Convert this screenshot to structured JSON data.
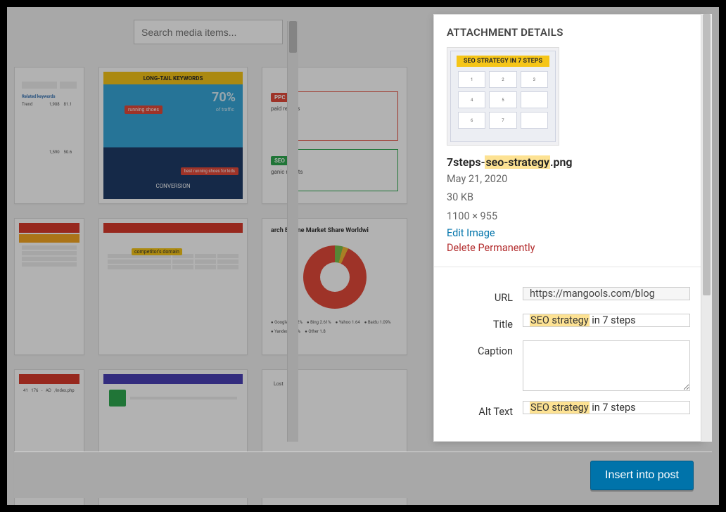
{
  "search": {
    "placeholder": "Search media items..."
  },
  "panel": {
    "header": "ATTACHMENT DETAILS",
    "preview_title": "SEO STRATEGY IN 7 STEPS",
    "filename_pre": "7steps-",
    "filename_hl": "seo-strategy",
    "filename_post": ".png",
    "date": "May 21, 2020",
    "size": "30 KB",
    "dimensions": "1100 × 955",
    "edit": "Edit Image",
    "delete": "Delete Permanently",
    "form": {
      "url_label": "URL",
      "url_value": "https://mangools.com/blog",
      "title_label": "Title",
      "title_hl": "SEO strategy",
      "title_rest": " in 7 steps",
      "caption_label": "Caption",
      "caption_value": "",
      "alt_label": "Alt Text",
      "alt_hl": "SEO strategy",
      "alt_rest": " in 7 steps"
    }
  },
  "footer": {
    "insert": "Insert into post"
  },
  "thumbs": {
    "t2_title": "LONG-TAIL KEYWORDS",
    "t2_pct": "70%",
    "t2_sub": "of traffic",
    "t2_bot": "CONVERSION",
    "t2_tag1": "running shoes",
    "t2_tag2": "best running shoes for kids",
    "t3_ppc": "PPC",
    "t3_ppc_sub": "paid results",
    "t3_seo": "SEO",
    "t3_seo_sub": "ganic results",
    "t6_title": "arch Engine Market Share Worldwi"
  }
}
